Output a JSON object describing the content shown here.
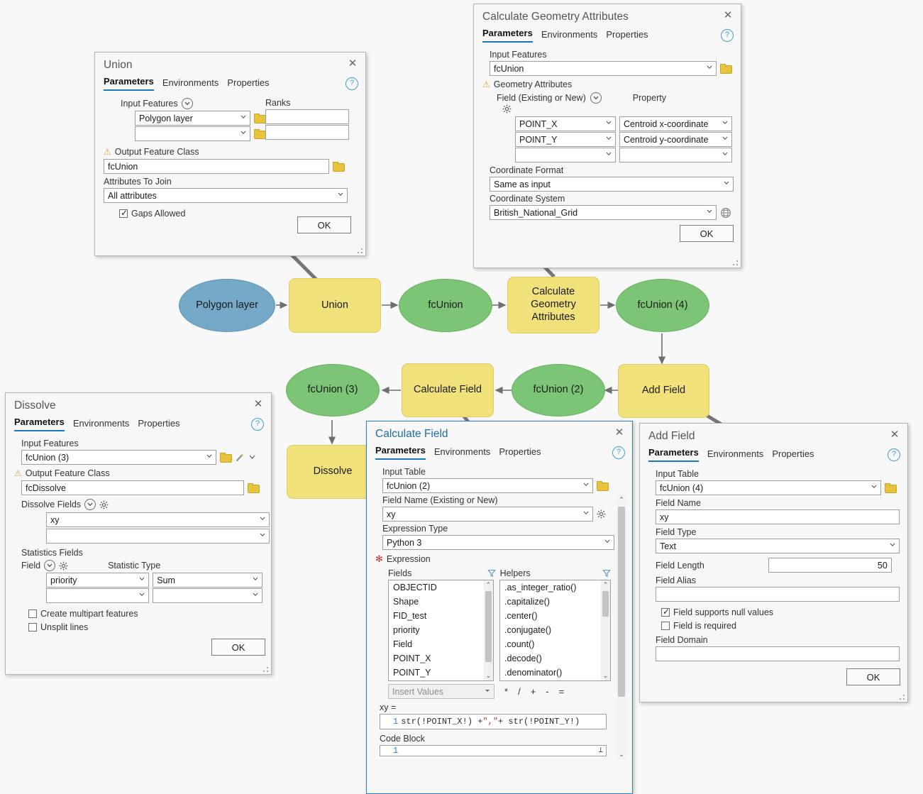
{
  "canvas": {
    "background_color": "#f8f8f8",
    "node_colors": {
      "input_blue": "#74a9c7",
      "tool_yellow": "#f0e17b",
      "output_green": "#7cc576"
    },
    "nodes": [
      {
        "id": "polygon-layer",
        "label": "Polygon layer",
        "shape": "oval",
        "color": "blue"
      },
      {
        "id": "union",
        "label": "Union",
        "shape": "rect",
        "color": "yellow"
      },
      {
        "id": "fcunion",
        "label": "fcUnion",
        "shape": "oval",
        "color": "green"
      },
      {
        "id": "calculate-geometry-attributes",
        "label": "Calculate Geometry Attributes",
        "shape": "rect",
        "color": "yellow"
      },
      {
        "id": "fcunion-4",
        "label": "fcUnion (4)",
        "shape": "oval",
        "color": "green"
      },
      {
        "id": "add-field",
        "label": "Add Field",
        "shape": "rect",
        "color": "yellow"
      },
      {
        "id": "fcunion-2",
        "label": "fcUnion (2)",
        "shape": "oval",
        "color": "green"
      },
      {
        "id": "calculate-field",
        "label": "Calculate Field",
        "shape": "rect",
        "color": "yellow"
      },
      {
        "id": "fcunion-3",
        "label": "fcUnion (3)",
        "shape": "oval",
        "color": "green"
      },
      {
        "id": "dissolve",
        "label": "Dissolve",
        "shape": "rect",
        "color": "yellow"
      }
    ]
  },
  "common": {
    "tabs": [
      "Parameters",
      "Environments",
      "Properties"
    ],
    "selected_tab": "Parameters",
    "help_glyph": "?",
    "close_glyph": "✕",
    "ok_label": "OK",
    "warn_glyph": "⚠"
  },
  "union_dialog": {
    "title": "Union",
    "input_features_label": "Input Features",
    "ranks_label": "Ranks",
    "input_features_rows": [
      "Polygon layer",
      ""
    ],
    "ranks_rows": [
      "",
      ""
    ],
    "output_feature_class_label": "Output Feature Class",
    "output_feature_class_value": "fcUnion",
    "attributes_to_join_label": "Attributes To Join",
    "attributes_to_join_value": "All attributes",
    "gaps_allowed_label": "Gaps Allowed",
    "gaps_allowed_checked": true
  },
  "calc_geometry_dialog": {
    "title": "Calculate Geometry Attributes",
    "input_features_label": "Input Features",
    "input_features_value": "fcUnion",
    "geometry_attributes_label": "Geometry Attributes",
    "field_label": "Field (Existing or New)",
    "property_label": "Property",
    "rows": [
      {
        "field": "POINT_X",
        "property": "Centroid x-coordinate"
      },
      {
        "field": "POINT_Y",
        "property": "Centroid y-coordinate"
      },
      {
        "field": "",
        "property": ""
      }
    ],
    "coordinate_format_label": "Coordinate Format",
    "coordinate_format_value": "Same as input",
    "coordinate_system_label": "Coordinate System",
    "coordinate_system_value": "British_National_Grid"
  },
  "dissolve_dialog": {
    "title": "Dissolve",
    "input_features_label": "Input Features",
    "input_features_value": "fcUnion (3)",
    "output_feature_class_label": "Output Feature Class",
    "output_feature_class_value": "fcDissolve",
    "dissolve_fields_label": "Dissolve Fields",
    "dissolve_fields_rows": [
      "xy",
      ""
    ],
    "statistics_fields_label": "Statistics Fields",
    "field_label": "Field",
    "statistic_type_label": "Statistic Type",
    "statistics_rows": [
      {
        "field": "priority",
        "type": "Sum"
      },
      {
        "field": "",
        "type": ""
      }
    ],
    "create_multipart_label": "Create multipart features",
    "create_multipart_checked": false,
    "unsplit_lines_label": "Unsplit lines",
    "unsplit_lines_checked": false
  },
  "calc_field_dialog": {
    "title": "Calculate Field",
    "input_table_label": "Input Table",
    "input_table_value": "fcUnion (2)",
    "field_name_label": "Field Name (Existing or New)",
    "field_name_value": "xy",
    "expression_type_label": "Expression Type",
    "expression_type_value": "Python 3",
    "expression_label": "Expression",
    "required_glyph": "✻",
    "fields_label": "Fields",
    "helpers_label": "Helpers",
    "fields_items": [
      "OBJECTID",
      "Shape",
      "FID_test",
      "priority",
      "Field",
      "POINT_X",
      "POINT_Y"
    ],
    "helpers_items": [
      ".as_integer_ratio()",
      ".capitalize()",
      ".center()",
      ".conjugate()",
      ".count()",
      ".decode()",
      ".denominator()"
    ],
    "insert_values_placeholder": "Insert Values",
    "operators": [
      "*",
      "/",
      "+",
      "-",
      "="
    ],
    "expression_caption": "xy =",
    "expression_line_number": "1",
    "expression_code_part1": "str(!POINT_X!) + ",
    "expression_code_string": "\",\"",
    "expression_code_part2": " + str(!POINT_Y!)",
    "code_block_label": "Code Block",
    "code_block_line_number": "1"
  },
  "add_field_dialog": {
    "title": "Add Field",
    "input_table_label": "Input Table",
    "input_table_value": "fcUnion (4)",
    "field_name_label": "Field Name",
    "field_name_value": "xy",
    "field_type_label": "Field Type",
    "field_type_value": "Text",
    "field_length_label": "Field Length",
    "field_length_value": "50",
    "field_alias_label": "Field Alias",
    "field_alias_value": "",
    "supports_null_label": "Field supports null values",
    "supports_null_checked": true,
    "field_required_label": "Field is required",
    "field_required_checked": false,
    "field_domain_label": "Field Domain",
    "field_domain_value": ""
  }
}
